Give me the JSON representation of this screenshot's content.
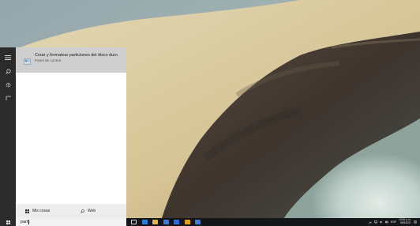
{
  "search": {
    "query": "part"
  },
  "best_match": {
    "title": "Crear y formatear particiones del disco duro",
    "subtitle": "Panel de control"
  },
  "scope_bar": {
    "apps_label": "Mis cosas",
    "web_label": "Web"
  },
  "start_rail": {
    "icons": [
      "hamburger-menu-icon",
      "search-icon",
      "gear-icon",
      "feedback-icon"
    ]
  },
  "taskbar": {
    "apps": [
      {
        "icon": "task-view-icon",
        "color": "#dcdcdc"
      },
      {
        "icon": "edge-icon",
        "color": "#2f7fd4"
      },
      {
        "icon": "file-explorer-icon",
        "color": "#e3b341"
      },
      {
        "icon": "store-icon",
        "color": "#3b7ad6"
      },
      {
        "icon": "outlook-icon",
        "color": "#2a6fd1"
      },
      {
        "icon": "chrome-icon",
        "color": "#e0a31a"
      },
      {
        "icon": "app-ai-icon",
        "color": "#3c7bd9"
      }
    ],
    "tray": {
      "language": "ESP",
      "time": "10:06 p. m.",
      "date": "9/05/2017"
    }
  },
  "colors": {
    "sand": "#d6c79c",
    "water_dark": "#3b3530",
    "water_light": "#c8d6cf",
    "sea": "#9fb2b4",
    "panel_selected": "#cfcfcf"
  }
}
